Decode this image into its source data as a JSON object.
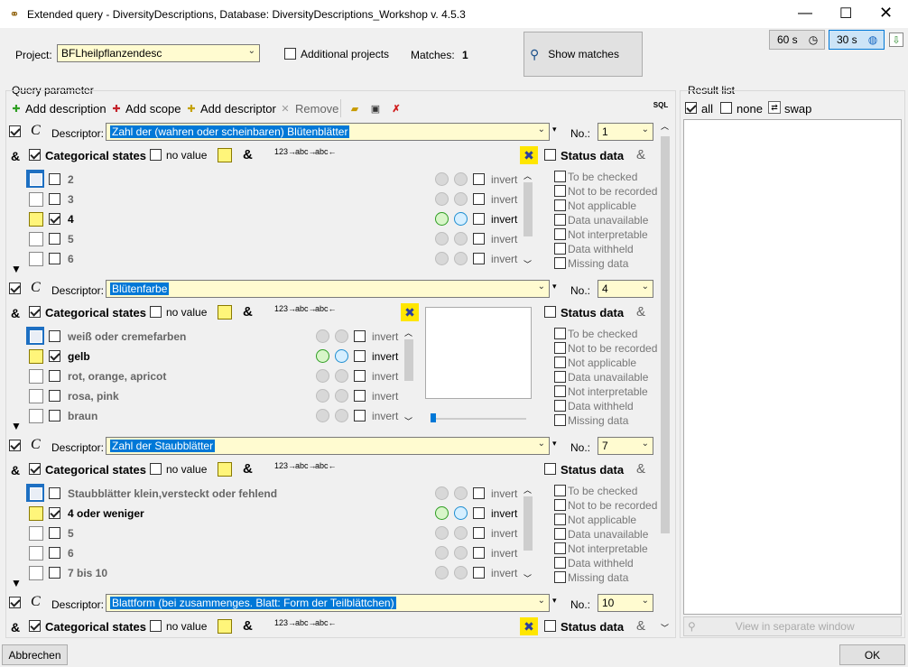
{
  "window": {
    "title": "Extended query - DiversityDescriptions,  Database: DiversityDescriptions_Workshop    v. 4.5.3",
    "timer60": "60 s",
    "timer30": "30 s"
  },
  "top": {
    "project_label": "Project:",
    "project_value": "BFLheilpflanzendesc",
    "additional_projects": "Additional projects",
    "matches_label": "Matches:",
    "matches_value": "1",
    "show_matches": "Show matches"
  },
  "query": {
    "group_label": "Query parameter",
    "add_description": "Add description",
    "add_scope": "Add scope",
    "add_descriptor": "Add descriptor",
    "remove": "Remove"
  },
  "common": {
    "descriptor_label": "Descriptor:",
    "no_label": "No.:",
    "categorical_states": "Categorical states",
    "no_value": "no value",
    "status_data": "Status data",
    "invert": "invert",
    "amp": "&"
  },
  "status_items": [
    "To be checked",
    "Not to be recorded",
    "Not applicable",
    "Data unavailable",
    "Not interpretable",
    "Data withheld",
    "Missing data"
  ],
  "blocks": [
    {
      "descriptor": "Zahl der (wahren oder scheinbaren) Blütenblätter",
      "no": "1",
      "states": [
        "2",
        "3",
        "4",
        "5",
        "6"
      ],
      "checked": 2
    },
    {
      "descriptor": "Blütenfarbe",
      "no": "4",
      "states": [
        "weiß oder cremefarben",
        "gelb",
        "rot, orange, apricot",
        "rosa, pink",
        "braun"
      ],
      "checked": 1
    },
    {
      "descriptor": "Zahl der Staubblätter",
      "no": "7",
      "states": [
        "Staubblätter klein,versteckt oder fehlend",
        "4 oder weniger",
        "5",
        "6",
        "7 bis 10"
      ],
      "checked": 1
    },
    {
      "descriptor": "Blattform (bei zusammenges. Blatt: Form der Teilblättchen)",
      "no": "10"
    }
  ],
  "result": {
    "group_label": "Result list",
    "all": "all",
    "none": "none",
    "swap": "swap",
    "view_separate": "View in separate window"
  },
  "footer": {
    "cancel": "Abbrechen",
    "ok": "OK"
  },
  "icons": {
    "binoculars": "binoculars-icon",
    "clock": "clock-icon",
    "globe": "globe-clock-icon",
    "save": "save-icon",
    "folder": "folder-icon"
  }
}
